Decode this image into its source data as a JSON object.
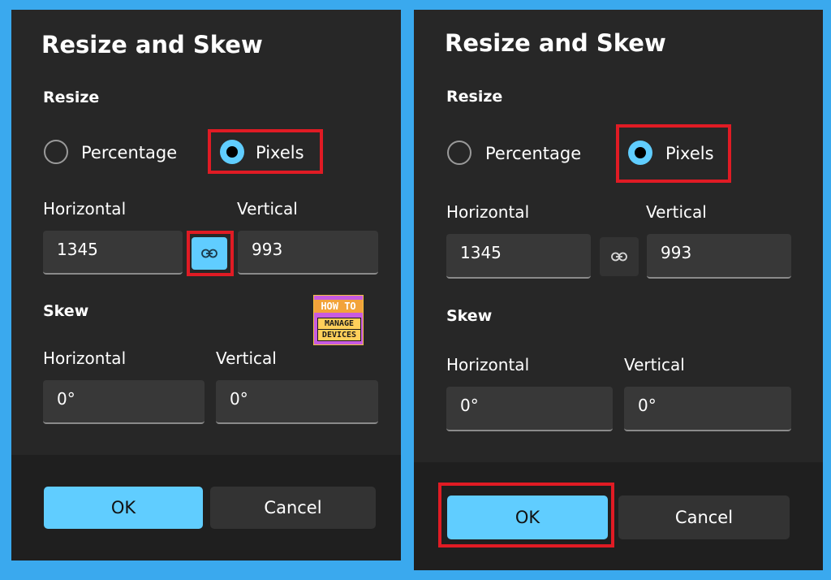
{
  "colors": {
    "accent": "#60cdff",
    "highlight": "#e01b24",
    "dialog_bg": "#272727",
    "page_bg": "#3aa9ee"
  },
  "left": {
    "title": "Resize and Skew",
    "resize_label": "Resize",
    "radio_percentage": "Percentage",
    "radio_pixels": "Pixels",
    "selected_unit": "Pixels",
    "resize_horizontal_label": "Horizontal",
    "resize_vertical_label": "Vertical",
    "resize_horizontal_value": "1345",
    "resize_vertical_value": "993",
    "aspect_lock": "on",
    "skew_label": "Skew",
    "skew_horizontal_label": "Horizontal",
    "skew_vertical_label": "Vertical",
    "skew_horizontal_value": "0°",
    "skew_vertical_value": "0°",
    "ok": "OK",
    "cancel": "Cancel"
  },
  "right": {
    "title": "Resize and Skew",
    "resize_label": "Resize",
    "radio_percentage": "Percentage",
    "radio_pixels": "Pixels",
    "selected_unit": "Pixels",
    "resize_horizontal_label": "Horizontal",
    "resize_vertical_label": "Vertical",
    "resize_horizontal_value": "1345",
    "resize_vertical_value": "993",
    "aspect_lock": "off",
    "skew_label": "Skew",
    "skew_horizontal_label": "Horizontal",
    "skew_vertical_label": "Vertical",
    "skew_horizontal_value": "0°",
    "skew_vertical_value": "0°",
    "ok": "OK",
    "cancel": "Cancel"
  },
  "logo": {
    "line1": "HOW TO",
    "line2": "MANAGE",
    "line3": "DEVICES"
  },
  "icons": {
    "aspect_lock": "link-icon"
  }
}
